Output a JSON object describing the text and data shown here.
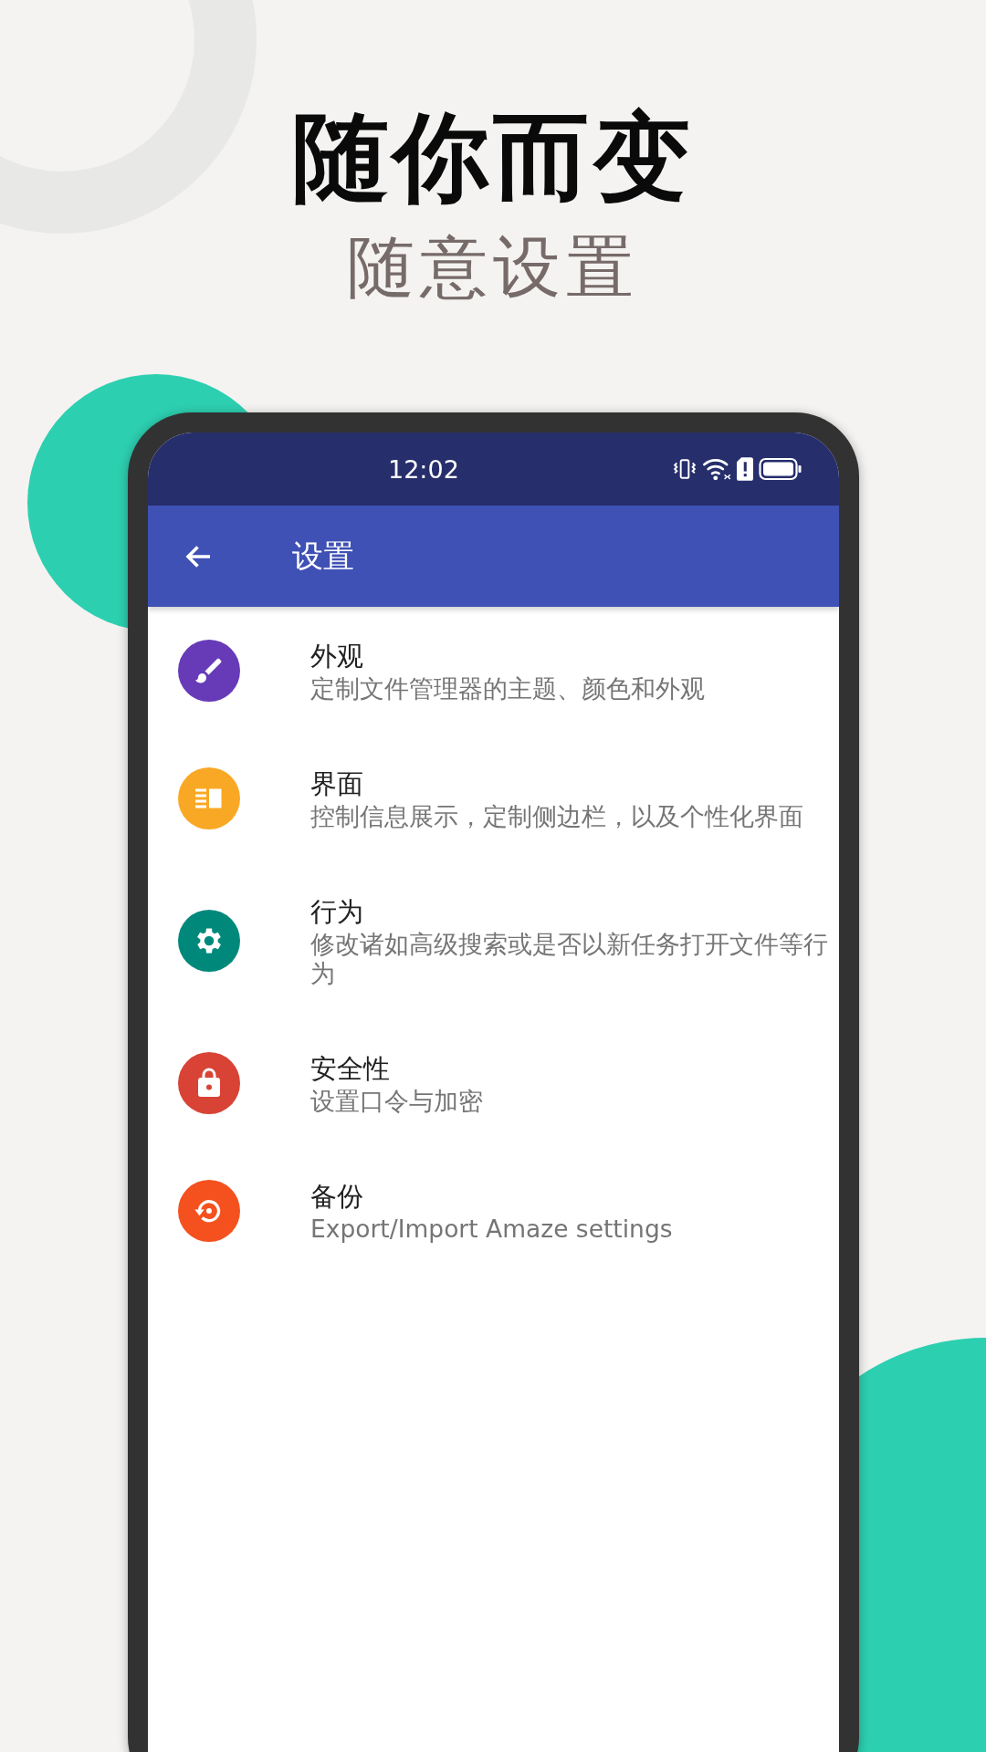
{
  "headline": "随你而变",
  "subheadline": "随意设置",
  "status_bar": {
    "time": "12:02"
  },
  "app_bar": {
    "title": "设置"
  },
  "items": [
    {
      "title": "外观",
      "subtitle": "定制文件管理器的主题、颜色和外观",
      "color": "#673ab7"
    },
    {
      "title": "界面",
      "subtitle": "控制信息展示，定制侧边栏，以及个性化界面",
      "color": "#f9a825"
    },
    {
      "title": "行为",
      "subtitle": "修改诸如高级搜索或是否以新任务打开文件等行为",
      "color": "#00897b"
    },
    {
      "title": "安全性",
      "subtitle": "设置口令与加密",
      "color": "#d84335"
    },
    {
      "title": "备份",
      "subtitle": "Export/Import Amaze settings",
      "color": "#f4511e"
    }
  ]
}
